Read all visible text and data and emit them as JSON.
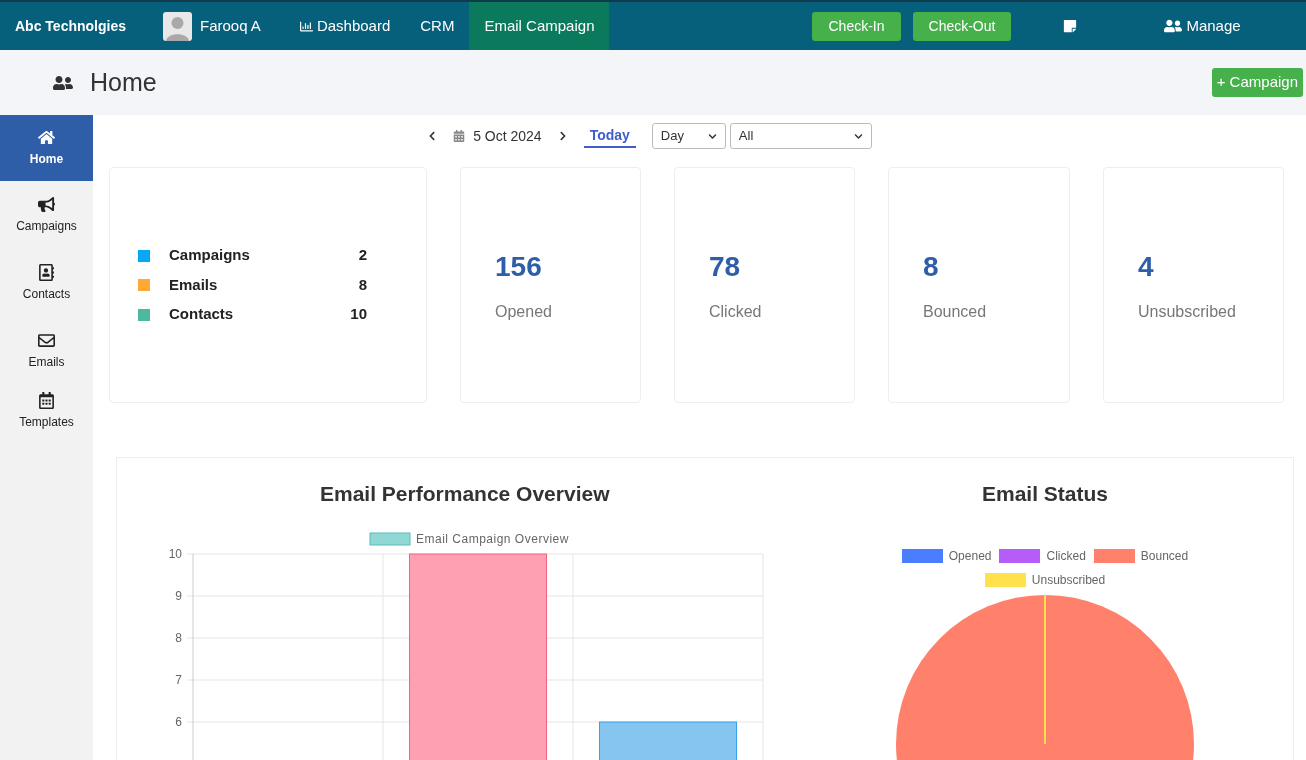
{
  "brand": "Abc Technolgies",
  "user": {
    "name": "Farooq A"
  },
  "nav": [
    {
      "label": "Dashboard",
      "selected": false
    },
    {
      "label": "CRM",
      "selected": false
    },
    {
      "label": "Email Campaign",
      "selected": true
    }
  ],
  "actions": [
    "Check-In",
    "Check-Out"
  ],
  "manage": "Manage",
  "page": {
    "title": "Home",
    "button": "+ Campaign"
  },
  "sidebar": [
    {
      "label": "Home",
      "selected": true
    },
    {
      "label": "Campaigns",
      "selected": false
    },
    {
      "label": "Contacts",
      "selected": false
    },
    {
      "label": "Emails",
      "selected": false
    },
    {
      "label": "Templates",
      "selected": false
    }
  ],
  "date_nav": {
    "date": "5 Oct 2024",
    "today": "Today",
    "period": "Day",
    "filter": "All"
  },
  "summary": [
    {
      "label": "Campaigns",
      "value": "2",
      "color": "#03a9f4"
    },
    {
      "label": "Emails",
      "value": "8",
      "color": "#ffa834"
    },
    {
      "label": "Contacts",
      "value": "10",
      "color": "#4cba9c"
    }
  ],
  "stats": [
    {
      "value": "156",
      "label": "Opened"
    },
    {
      "value": "78",
      "label": "Clicked"
    },
    {
      "value": "8",
      "label": "Bounced"
    },
    {
      "value": "4",
      "label": "Unsubscribed"
    }
  ],
  "performance": {
    "title": "Email Performance Overview",
    "chart_data": {
      "type": "bar",
      "grid": true,
      "ylim": [
        5,
        10
      ],
      "yticks": [
        6,
        7,
        8,
        9,
        10
      ],
      "series": [
        {
          "name": "Email Campaign Overview",
          "values": [
            null,
            10,
            6
          ]
        }
      ]
    }
  },
  "status": {
    "title": "Email Status",
    "legend": [
      {
        "label": "Opened",
        "color": "#4b7dff"
      },
      {
        "label": "Clicked",
        "color": "#b65cf8"
      },
      {
        "label": "Bounced",
        "color": "#ff806b"
      },
      {
        "label": "Unsubscribed",
        "color": "#ffe14b"
      }
    ]
  }
}
